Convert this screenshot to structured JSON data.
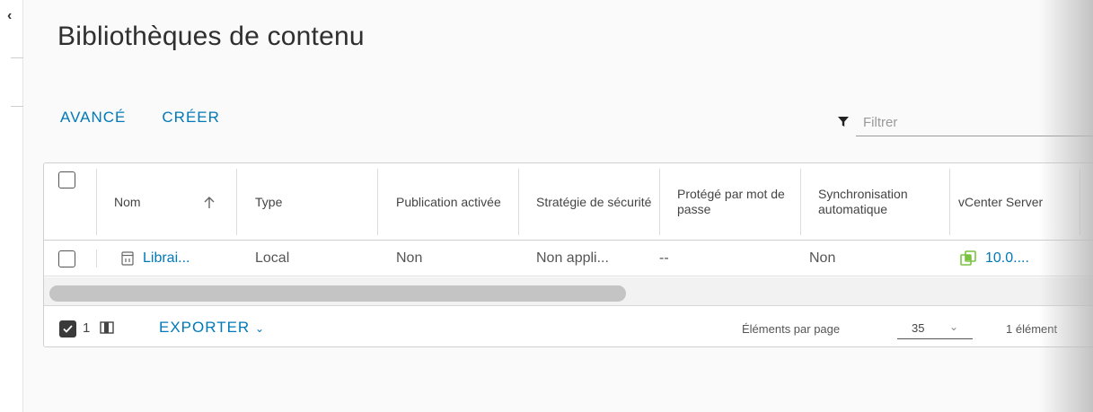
{
  "title": "Bibliothèques de contenu",
  "actions": {
    "advanced": "AVANCÉ",
    "create": "CRÉER"
  },
  "filter": {
    "placeholder": "Filtrer"
  },
  "table": {
    "columns": {
      "name": "Nom",
      "type": "Type",
      "publication": "Publication activée",
      "security": "Stratégie de sécurité",
      "password": "Protégé par mot de passe",
      "sync": "Synchronisation automatique",
      "vcenter": "vCenter Server"
    },
    "rows": [
      {
        "name": "Librai...",
        "type": "Local",
        "publication": "Non",
        "security": "Non appli...",
        "password": "--",
        "sync": "Non",
        "vcenter": "10.0...."
      }
    ]
  },
  "footer": {
    "selected_count": "1",
    "export": "EXPORTER",
    "per_page_label": "Éléments par page",
    "page_size": "35",
    "total": "1 élément"
  },
  "colors": {
    "accent": "#0079b8",
    "vcenter_icon": "#7cc242"
  },
  "icons": {
    "sort": "arrow-up-icon",
    "library": "library-icon",
    "vcenter": "vcenter-icon",
    "filter": "funnel-icon",
    "columns": "column-toggle-icon",
    "export_dropdown": "chevron-down-icon"
  }
}
